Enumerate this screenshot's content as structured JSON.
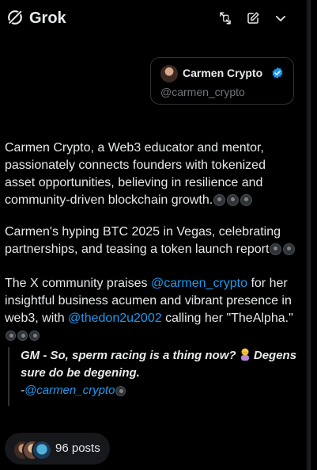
{
  "app": {
    "title": "Grok"
  },
  "header": {
    "icons": [
      "expand-icon",
      "compose-icon",
      "chevron-down-icon"
    ]
  },
  "profile_card": {
    "name": "Carmen Crypto",
    "handle": "@carmen_crypto",
    "verified": true
  },
  "paragraphs": {
    "p1": "Carmen Crypto, a Web3 educator and mentor, passionately connects founders with tokenized asset opportunities, believing in resilience and community-driven blockchain growth.",
    "p2": "Carmen's hyping BTC 2025 in Vegas, celebrating partnerships, and teasing a token launch report",
    "p3_before": "The X community praises ",
    "p3_link1": "@carmen_crypto",
    "p3_mid": " for her insightful business acumen and vibrant presence in web3, with ",
    "p3_link2": "@thedon2u2002",
    "p3_after": " calling her \"TheAlpha.\""
  },
  "quote": {
    "line1": "GM - So, sperm racing is a thing now?",
    "line2": " Degens sure do be degening.",
    "attr_prefix": "-",
    "attr_handle": "@carmen_crypto"
  },
  "posts_pill": {
    "label": "96 posts"
  },
  "colors": {
    "background": "#000000",
    "text": "#e7e9ea",
    "muted": "#71767b",
    "link": "#1d9bf0",
    "border": "#2f3336",
    "verified": "#1d9bf0"
  }
}
